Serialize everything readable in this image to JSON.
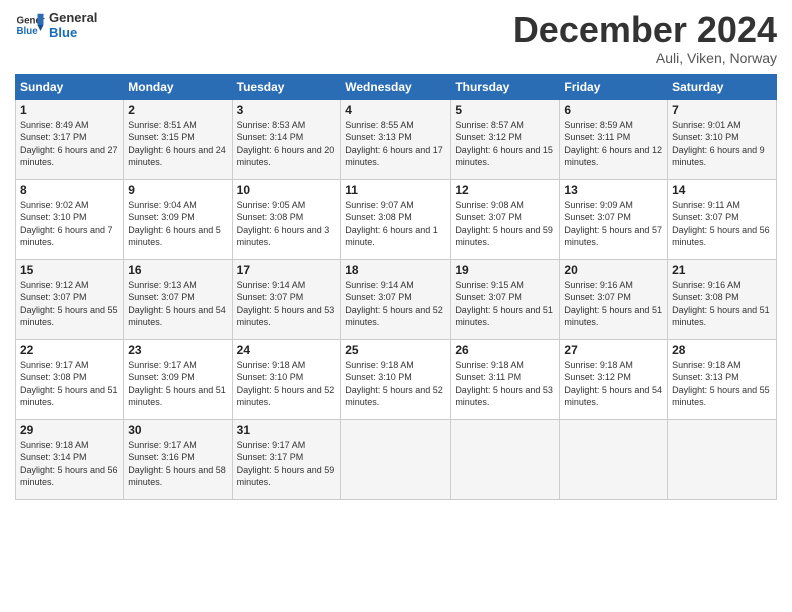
{
  "header": {
    "logo_line1": "General",
    "logo_line2": "Blue",
    "month": "December 2024",
    "location": "Auli, Viken, Norway"
  },
  "weekdays": [
    "Sunday",
    "Monday",
    "Tuesday",
    "Wednesday",
    "Thursday",
    "Friday",
    "Saturday"
  ],
  "weeks": [
    [
      {
        "day": "1",
        "sunrise": "Sunrise: 8:49 AM",
        "sunset": "Sunset: 3:17 PM",
        "daylight": "Daylight: 6 hours and 27 minutes."
      },
      {
        "day": "2",
        "sunrise": "Sunrise: 8:51 AM",
        "sunset": "Sunset: 3:15 PM",
        "daylight": "Daylight: 6 hours and 24 minutes."
      },
      {
        "day": "3",
        "sunrise": "Sunrise: 8:53 AM",
        "sunset": "Sunset: 3:14 PM",
        "daylight": "Daylight: 6 hours and 20 minutes."
      },
      {
        "day": "4",
        "sunrise": "Sunrise: 8:55 AM",
        "sunset": "Sunset: 3:13 PM",
        "daylight": "Daylight: 6 hours and 17 minutes."
      },
      {
        "day": "5",
        "sunrise": "Sunrise: 8:57 AM",
        "sunset": "Sunset: 3:12 PM",
        "daylight": "Daylight: 6 hours and 15 minutes."
      },
      {
        "day": "6",
        "sunrise": "Sunrise: 8:59 AM",
        "sunset": "Sunset: 3:11 PM",
        "daylight": "Daylight: 6 hours and 12 minutes."
      },
      {
        "day": "7",
        "sunrise": "Sunrise: 9:01 AM",
        "sunset": "Sunset: 3:10 PM",
        "daylight": "Daylight: 6 hours and 9 minutes."
      }
    ],
    [
      {
        "day": "8",
        "sunrise": "Sunrise: 9:02 AM",
        "sunset": "Sunset: 3:10 PM",
        "daylight": "Daylight: 6 hours and 7 minutes."
      },
      {
        "day": "9",
        "sunrise": "Sunrise: 9:04 AM",
        "sunset": "Sunset: 3:09 PM",
        "daylight": "Daylight: 6 hours and 5 minutes."
      },
      {
        "day": "10",
        "sunrise": "Sunrise: 9:05 AM",
        "sunset": "Sunset: 3:08 PM",
        "daylight": "Daylight: 6 hours and 3 minutes."
      },
      {
        "day": "11",
        "sunrise": "Sunrise: 9:07 AM",
        "sunset": "Sunset: 3:08 PM",
        "daylight": "Daylight: 6 hours and 1 minute."
      },
      {
        "day": "12",
        "sunrise": "Sunrise: 9:08 AM",
        "sunset": "Sunset: 3:07 PM",
        "daylight": "Daylight: 5 hours and 59 minutes."
      },
      {
        "day": "13",
        "sunrise": "Sunrise: 9:09 AM",
        "sunset": "Sunset: 3:07 PM",
        "daylight": "Daylight: 5 hours and 57 minutes."
      },
      {
        "day": "14",
        "sunrise": "Sunrise: 9:11 AM",
        "sunset": "Sunset: 3:07 PM",
        "daylight": "Daylight: 5 hours and 56 minutes."
      }
    ],
    [
      {
        "day": "15",
        "sunrise": "Sunrise: 9:12 AM",
        "sunset": "Sunset: 3:07 PM",
        "daylight": "Daylight: 5 hours and 55 minutes."
      },
      {
        "day": "16",
        "sunrise": "Sunrise: 9:13 AM",
        "sunset": "Sunset: 3:07 PM",
        "daylight": "Daylight: 5 hours and 54 minutes."
      },
      {
        "day": "17",
        "sunrise": "Sunrise: 9:14 AM",
        "sunset": "Sunset: 3:07 PM",
        "daylight": "Daylight: 5 hours and 53 minutes."
      },
      {
        "day": "18",
        "sunrise": "Sunrise: 9:14 AM",
        "sunset": "Sunset: 3:07 PM",
        "daylight": "Daylight: 5 hours and 52 minutes."
      },
      {
        "day": "19",
        "sunrise": "Sunrise: 9:15 AM",
        "sunset": "Sunset: 3:07 PM",
        "daylight": "Daylight: 5 hours and 51 minutes."
      },
      {
        "day": "20",
        "sunrise": "Sunrise: 9:16 AM",
        "sunset": "Sunset: 3:07 PM",
        "daylight": "Daylight: 5 hours and 51 minutes."
      },
      {
        "day": "21",
        "sunrise": "Sunrise: 9:16 AM",
        "sunset": "Sunset: 3:08 PM",
        "daylight": "Daylight: 5 hours and 51 minutes."
      }
    ],
    [
      {
        "day": "22",
        "sunrise": "Sunrise: 9:17 AM",
        "sunset": "Sunset: 3:08 PM",
        "daylight": "Daylight: 5 hours and 51 minutes."
      },
      {
        "day": "23",
        "sunrise": "Sunrise: 9:17 AM",
        "sunset": "Sunset: 3:09 PM",
        "daylight": "Daylight: 5 hours and 51 minutes."
      },
      {
        "day": "24",
        "sunrise": "Sunrise: 9:18 AM",
        "sunset": "Sunset: 3:10 PM",
        "daylight": "Daylight: 5 hours and 52 minutes."
      },
      {
        "day": "25",
        "sunrise": "Sunrise: 9:18 AM",
        "sunset": "Sunset: 3:10 PM",
        "daylight": "Daylight: 5 hours and 52 minutes."
      },
      {
        "day": "26",
        "sunrise": "Sunrise: 9:18 AM",
        "sunset": "Sunset: 3:11 PM",
        "daylight": "Daylight: 5 hours and 53 minutes."
      },
      {
        "day": "27",
        "sunrise": "Sunrise: 9:18 AM",
        "sunset": "Sunset: 3:12 PM",
        "daylight": "Daylight: 5 hours and 54 minutes."
      },
      {
        "day": "28",
        "sunrise": "Sunrise: 9:18 AM",
        "sunset": "Sunset: 3:13 PM",
        "daylight": "Daylight: 5 hours and 55 minutes."
      }
    ],
    [
      {
        "day": "29",
        "sunrise": "Sunrise: 9:18 AM",
        "sunset": "Sunset: 3:14 PM",
        "daylight": "Daylight: 5 hours and 56 minutes."
      },
      {
        "day": "30",
        "sunrise": "Sunrise: 9:17 AM",
        "sunset": "Sunset: 3:16 PM",
        "daylight": "Daylight: 5 hours and 58 minutes."
      },
      {
        "day": "31",
        "sunrise": "Sunrise: 9:17 AM",
        "sunset": "Sunset: 3:17 PM",
        "daylight": "Daylight: 5 hours and 59 minutes."
      },
      null,
      null,
      null,
      null
    ]
  ]
}
